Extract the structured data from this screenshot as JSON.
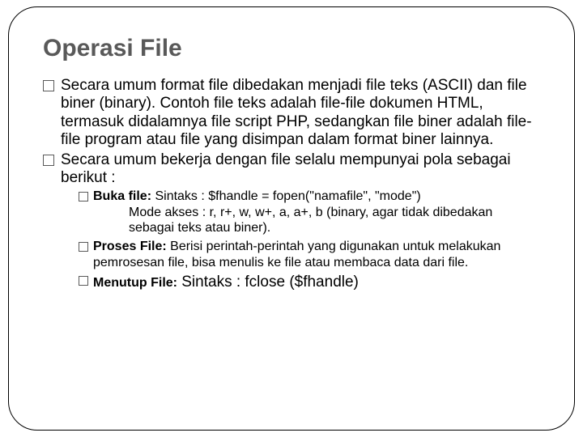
{
  "title": "Operasi File",
  "bullets": [
    {
      "text": "Secara umum format file dibedakan menjadi file teks (ASCII) dan file biner (binary). Contoh file teks adalah file-file dokumen HTML, termasuk didalamnya file script PHP, sedangkan file biner adalah file-file program atau file yang disimpan dalam format biner lainnya."
    },
    {
      "text": "Secara umum bekerja dengan file selalu mempunyai pola sebagai berikut :"
    }
  ],
  "subs": [
    {
      "bold": "Buka file:",
      "rest": " Sintaks : $fhandle = fopen(\"namafile\", \"mode\")",
      "indent": "Mode akses : r, r+, w, w+, a, a+, b (binary, agar tidak dibedakan sebagai teks atau biner)."
    },
    {
      "bold": "Proses File:",
      "rest": " Berisi perintah-perintah yang digunakan untuk melakukan pemrosesan    file, bisa menulis ke file atau membaca data dari file."
    },
    {
      "bold": "Menutup File:",
      "tail": " Sintaks : fclose ($fhandle)"
    }
  ]
}
